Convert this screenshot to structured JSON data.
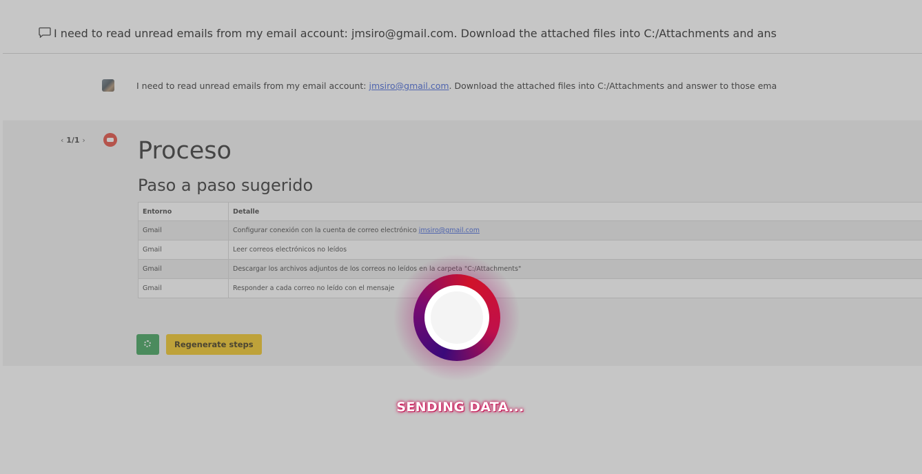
{
  "conversation": {
    "title": "I need to read unread emails from my email account: jmsiro@gmail.com. Download the attached files into C:/Attachments and ans"
  },
  "user_message": {
    "text_before": "I need to read unread emails from my email account: ",
    "link": "jmsiro@gmail.com",
    "text_after": ". Download the attached files into C:/Attachments and answer to those ema"
  },
  "assistant": {
    "pager": {
      "prev": "‹",
      "current": "1/1",
      "next": "›"
    },
    "heading": "Proceso",
    "subheading": "Paso a paso sugerido",
    "table": {
      "headers": [
        "Entorno",
        "Detalle"
      ],
      "rows": [
        {
          "entorno": "Gmail",
          "detalle": "Configurar conexión con la cuenta de correo electrónico ",
          "link": "jmsiro@gmail.com"
        },
        {
          "entorno": "Gmail",
          "detalle": "Leer correos electrónicos no leídos"
        },
        {
          "entorno": "Gmail",
          "detalle": "Descargar los archivos adjuntos de los correos no leídos en la carpeta \"C:/Attachments\""
        },
        {
          "entorno": "Gmail",
          "detalle": "Responder a cada correo no leído con el mensaje"
        }
      ]
    },
    "regenerate_label": "Regenerate steps"
  },
  "overlay": {
    "status_text": "SENDING DATA..."
  },
  "colors": {
    "spinner_button": "#2c9a4b",
    "regenerate_button": "#f1c10e",
    "link": "#2f55d4",
    "loader_red": "#d0122a",
    "loader_purple": "#3a0a7a"
  },
  "icons": {
    "conversation": "chat-bubble-icon",
    "bot": "code-bot-icon",
    "spinner": "loading-spinner-icon"
  }
}
